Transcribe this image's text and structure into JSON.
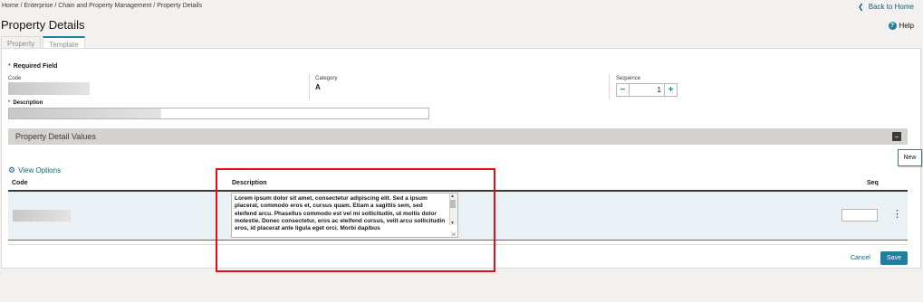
{
  "breadcrumb": "Home / Enterprise / Chain and Property Management / Property Details",
  "back_link": "Back to Home",
  "page_title": "Property Details",
  "help_label": "Help",
  "tabs": [
    {
      "label": "Property",
      "active": false
    },
    {
      "label": "Template",
      "active": true
    }
  ],
  "form": {
    "required_note": "Required Field",
    "code_label": "Code",
    "category_label": "Category",
    "category_value": "A",
    "sequence_label": "Sequence",
    "sequence_value": "1",
    "description_label": "Description"
  },
  "section": {
    "title": "Property Detail Values",
    "new_button": "New",
    "view_options": "View Options",
    "columns": [
      "Code",
      "Description",
      "Seq"
    ],
    "rows": [
      {
        "description": "Lorem ipsum dolor sit amet, consectetur adipiscing elit. Sed a ipsum placerat, commodo eros et, cursus quam. Etiam a sagittis sem, sed eleifend arcu. Phasellus commodo est vel mi sollicitudin, ut mollis dolor molestie. Donec consectetur, eros ac eleifend cursus, velit arcu sollicitudin eros, id placerat ante ligula eget orci. Morbi dapibus",
        "seq": ""
      }
    ]
  },
  "footer": {
    "cancel": "Cancel",
    "save": "Save"
  },
  "colors": {
    "accent": "#227e9e",
    "highlight_box": "#e10f16",
    "section_bar": "#d5d3cf"
  }
}
